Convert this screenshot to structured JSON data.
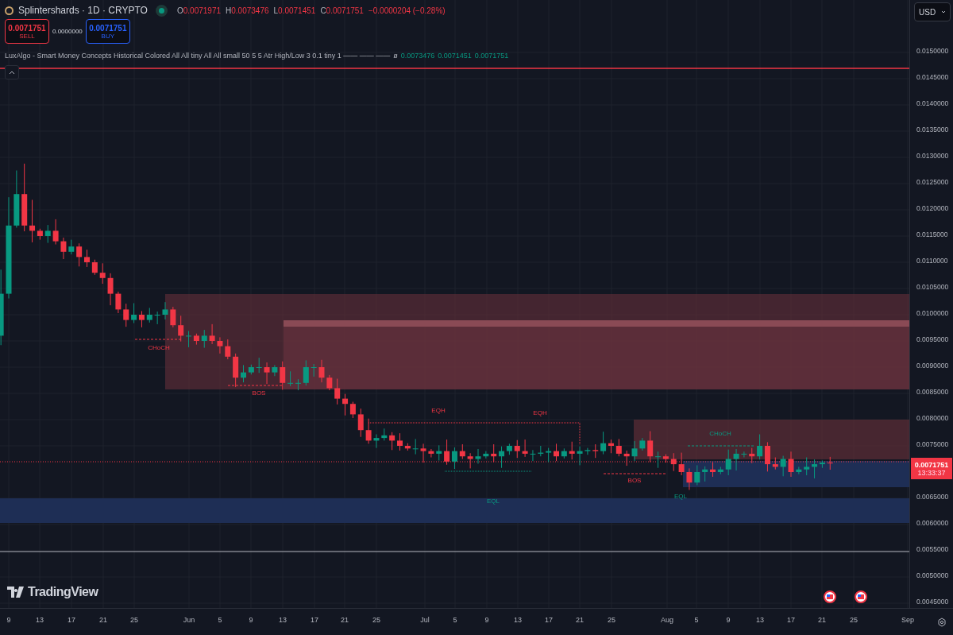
{
  "header": {
    "symbol": "Splintershards · 1D · CRYPTO",
    "market_open": true,
    "ohlc": [
      {
        "label": "O",
        "value": "0.0071971"
      },
      {
        "label": "H",
        "value": "0.0073476"
      },
      {
        "label": "L",
        "value": "0.0071451"
      },
      {
        "label": "C",
        "value": "0.0071751"
      }
    ],
    "change": "−0.0000204 (−0.28%)"
  },
  "trade": {
    "sell": {
      "price": "0.0071751",
      "label": "SELL"
    },
    "spread": "0.0000000",
    "buy": {
      "price": "0.0071751",
      "label": "BUY"
    }
  },
  "indicator": {
    "name": "LuxAlgo - Smart Money Concepts Historical Colored All All tiny All All small 50 5 5 Atr High/Low 3 0.1 tiny 1 —— —— ——",
    "symbol": "ø",
    "values": [
      "0.0073476",
      "0.0071451",
      "0.0071751"
    ]
  },
  "currency": "USD",
  "logo": "TradingView",
  "price_axis": {
    "ticks": [
      "0.0150000",
      "0.0145000",
      "0.0140000",
      "0.0135000",
      "0.0130000",
      "0.0125000",
      "0.0120000",
      "0.0115000",
      "0.0110000",
      "0.0105000",
      "0.0100000",
      "0.0095000",
      "0.0090000",
      "0.0085000",
      "0.0080000",
      "0.0075000",
      "0.0065000",
      "0.0060000",
      "0.0055000",
      "0.0050000",
      "0.0045000"
    ],
    "last_price": "0.0071751",
    "countdown": "13:33:37"
  },
  "time_axis": [
    "9",
    "13",
    "17",
    "21",
    "25",
    "Jun",
    "5",
    "9",
    "13",
    "17",
    "21",
    "25",
    "Jul",
    "5",
    "9",
    "13",
    "17",
    "21",
    "25",
    "Aug",
    "5",
    "9",
    "13",
    "17",
    "21",
    "25",
    "Sep"
  ],
  "chart_labels": [
    {
      "text": "CHoCH",
      "kind": "bearish"
    },
    {
      "text": "BOS",
      "kind": "bearish"
    },
    {
      "text": "EQH",
      "kind": "bearish"
    },
    {
      "text": "EQH",
      "kind": "bearish"
    },
    {
      "text": "EQL",
      "kind": "bullish"
    },
    {
      "text": "BOS",
      "kind": "bearish"
    },
    {
      "text": "EQL",
      "kind": "bullish"
    },
    {
      "text": "CHoCH",
      "kind": "bullish"
    }
  ]
}
